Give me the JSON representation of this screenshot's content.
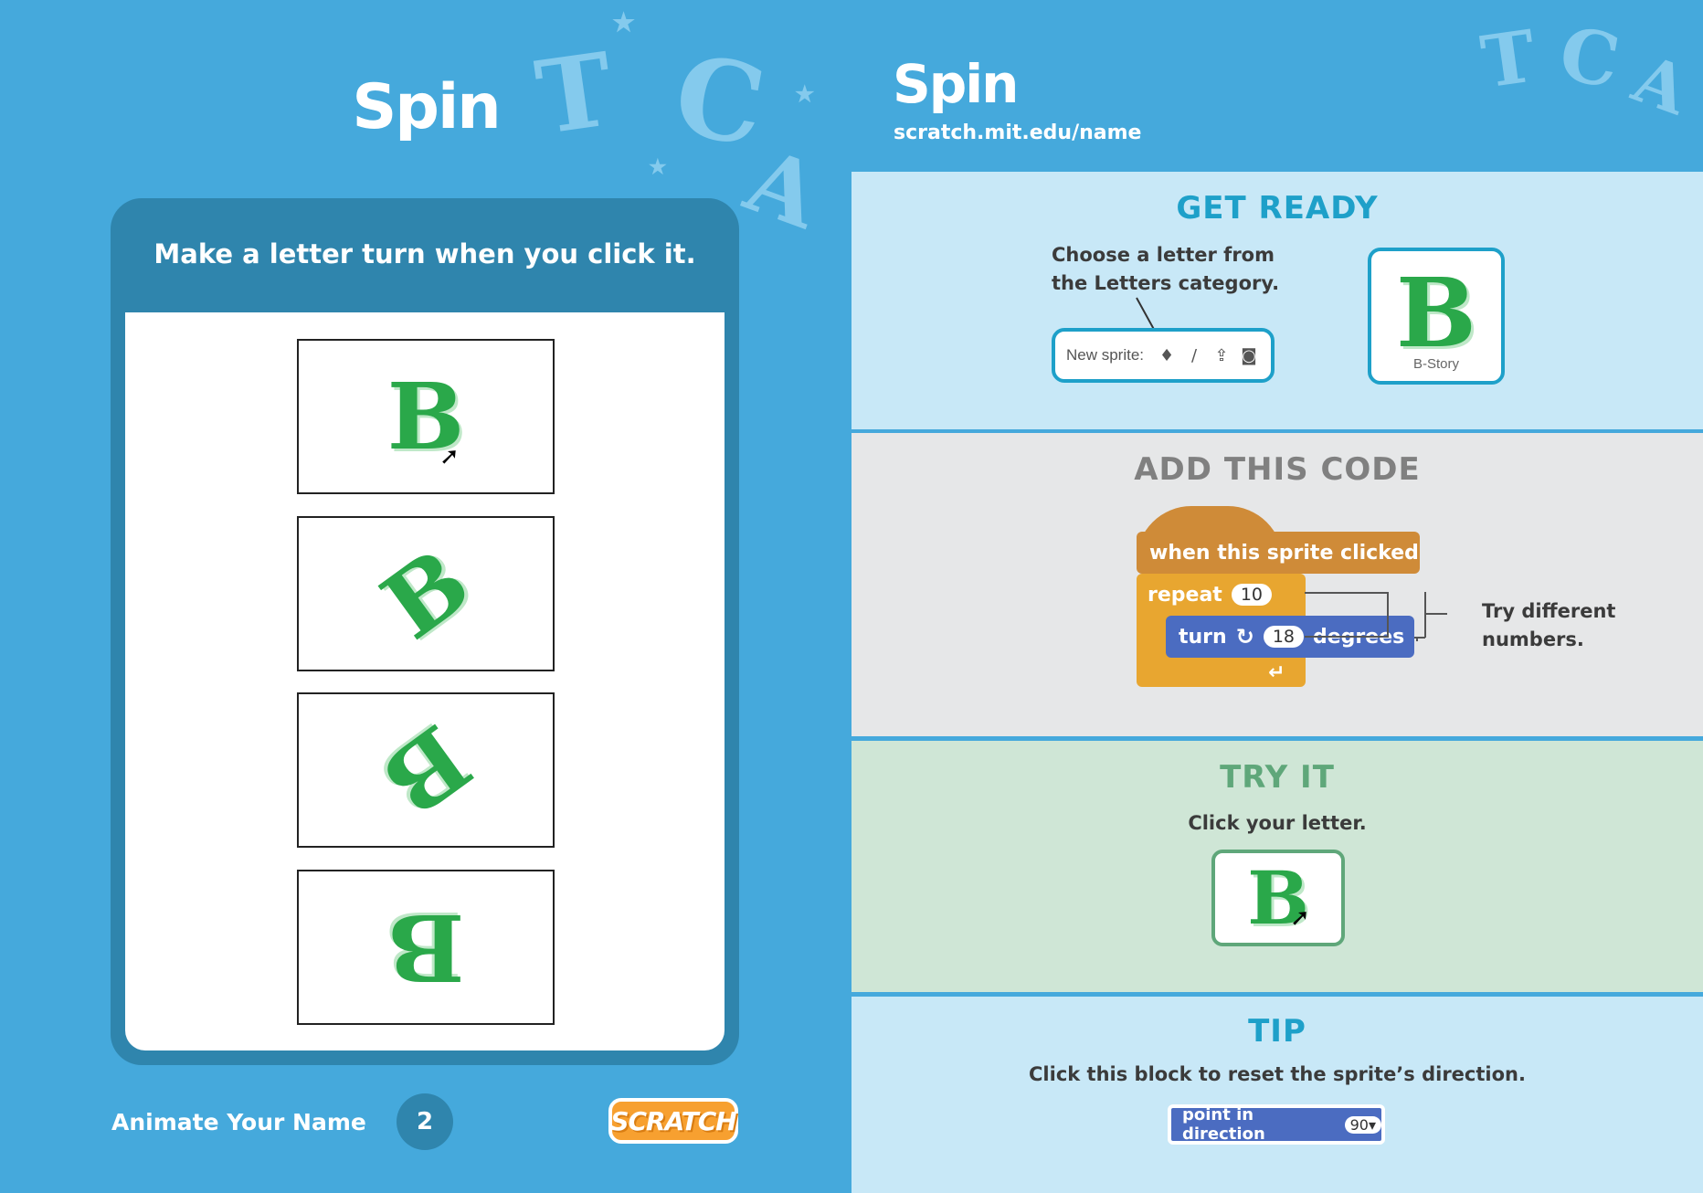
{
  "left": {
    "title": "Spin",
    "caption": "Make a letter turn when you click it.",
    "frames": [
      {
        "letter": "B",
        "rotation_deg": 0,
        "cursor": true
      },
      {
        "letter": "B",
        "rotation_deg": -36,
        "cursor": false
      },
      {
        "letter": "B",
        "rotation_deg": 144,
        "cursor": false
      },
      {
        "letter": "B",
        "rotation_deg": 180,
        "cursor": false
      }
    ],
    "footer_title": "Animate Your Name",
    "page_number": "2",
    "logo_text": "SCRATCH"
  },
  "right": {
    "title": "Spin",
    "url": "scratch.mit.edu/name",
    "get_ready": {
      "heading": "GET READY",
      "instruction_line1": "Choose a letter from",
      "instruction_line2": "the Letters category.",
      "new_sprite_label": "New sprite:",
      "new_sprite_icons": [
        "sprite-library-icon",
        "paint-brush-icon",
        "upload-icon",
        "camera-icon"
      ],
      "sprite_letter": "B",
      "sprite_name": "B-Story"
    },
    "add_code": {
      "heading": "ADD THIS CODE",
      "hat_block": "when this sprite clicked",
      "repeat_label": "repeat",
      "repeat_value": "10",
      "turn_label": "turn",
      "turn_value": "18",
      "turn_unit": "degrees",
      "note_line1": "Try different",
      "note_line2": "numbers."
    },
    "try_it": {
      "heading": "TRY IT",
      "instruction": "Click your letter.",
      "sprite_letter": "B"
    },
    "tip": {
      "heading": "TIP",
      "instruction": "Click this block to reset the sprite’s direction.",
      "block_label": "point in direction",
      "block_value": "90▾"
    }
  },
  "colors": {
    "page_blue": "#45a9dc",
    "card_dark_blue": "#2f85ad",
    "ready_bg": "#c8e8f7",
    "code_bg": "#e6e7e8",
    "try_bg": "#cfe6d6",
    "letter_green": "#2aa84a",
    "heading_ready": "#1ea0c9",
    "heading_code": "#808080",
    "heading_try": "#5fa77a",
    "events_block": "#cf8b38",
    "control_block": "#e8a630",
    "motion_block": "#4b6cc1"
  }
}
